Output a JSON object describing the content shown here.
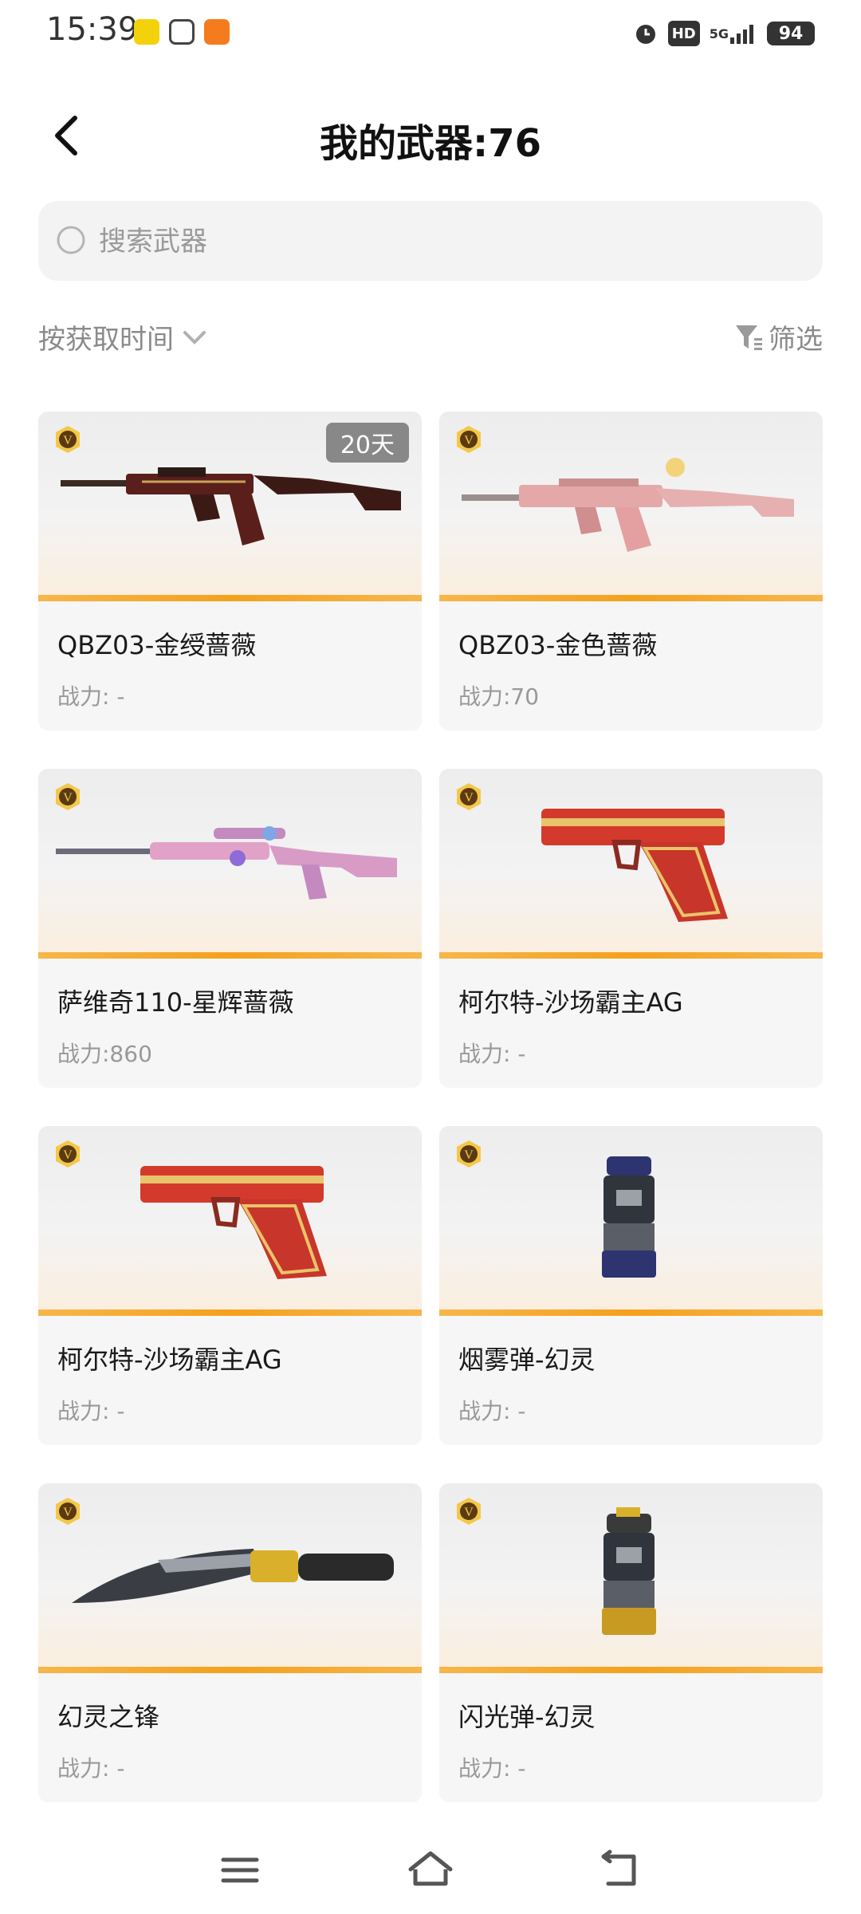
{
  "status": {
    "time": "15:39",
    "network": "5G",
    "hd": "HD",
    "battery": "94"
  },
  "header": {
    "title": "我的武器:76"
  },
  "search": {
    "placeholder": "搜索武器"
  },
  "sort": {
    "label": "按获取时间"
  },
  "filter": {
    "label": "筛选"
  },
  "weapons": [
    {
      "name": "QBZ03-金绶蔷薇",
      "power": "战力: -",
      "badge": "20天",
      "icon": "rifle-icon"
    },
    {
      "name": "QBZ03-金色蔷薇",
      "power": "战力:70",
      "icon": "rifle-icon"
    },
    {
      "name": "萨维奇110-星辉蔷薇",
      "power": "战力:860",
      "icon": "sniper-rifle-icon"
    },
    {
      "name": "柯尔特-沙场霸主AG",
      "power": "战力: -",
      "icon": "pistol-icon"
    },
    {
      "name": "柯尔特-沙场霸主AG",
      "power": "战力: -",
      "icon": "pistol-icon"
    },
    {
      "name": "烟雾弹-幻灵",
      "power": "战力: -",
      "icon": "smoke-grenade-icon"
    },
    {
      "name": "幻灵之锋",
      "power": "战力: -",
      "icon": "knife-icon"
    },
    {
      "name": "闪光弹-幻灵",
      "power": "战力: -",
      "icon": "flash-grenade-icon"
    }
  ],
  "colors": {
    "accent": "#f4a11c",
    "card_bg": "#f6f6f6",
    "muted_text": "#999999"
  }
}
